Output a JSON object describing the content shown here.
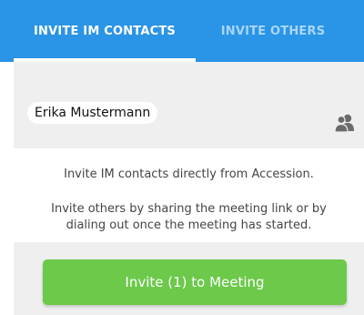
{
  "tabs": {
    "active_label": "INVITE IM CONTACTS",
    "inactive_label": "INVITE OTHERS"
  },
  "contacts": {
    "selected": [
      "Erika Mustermann"
    ],
    "picker_icon": "people-icon"
  },
  "info": {
    "line1": "Invite IM contacts directly from Accession.",
    "line2a": "Invite others by sharing the meeting link or by",
    "line2b": "dialing out once the meeting has started."
  },
  "footer": {
    "invite_label": "Invite (1) to Meeting"
  },
  "colors": {
    "tab_bar": "#2a94e6",
    "tab_inactive_text": "#a9d6fb",
    "invite_button": "#6cc94a",
    "panel_bg": "#efefef",
    "icon_gray": "#6b6b6b"
  }
}
